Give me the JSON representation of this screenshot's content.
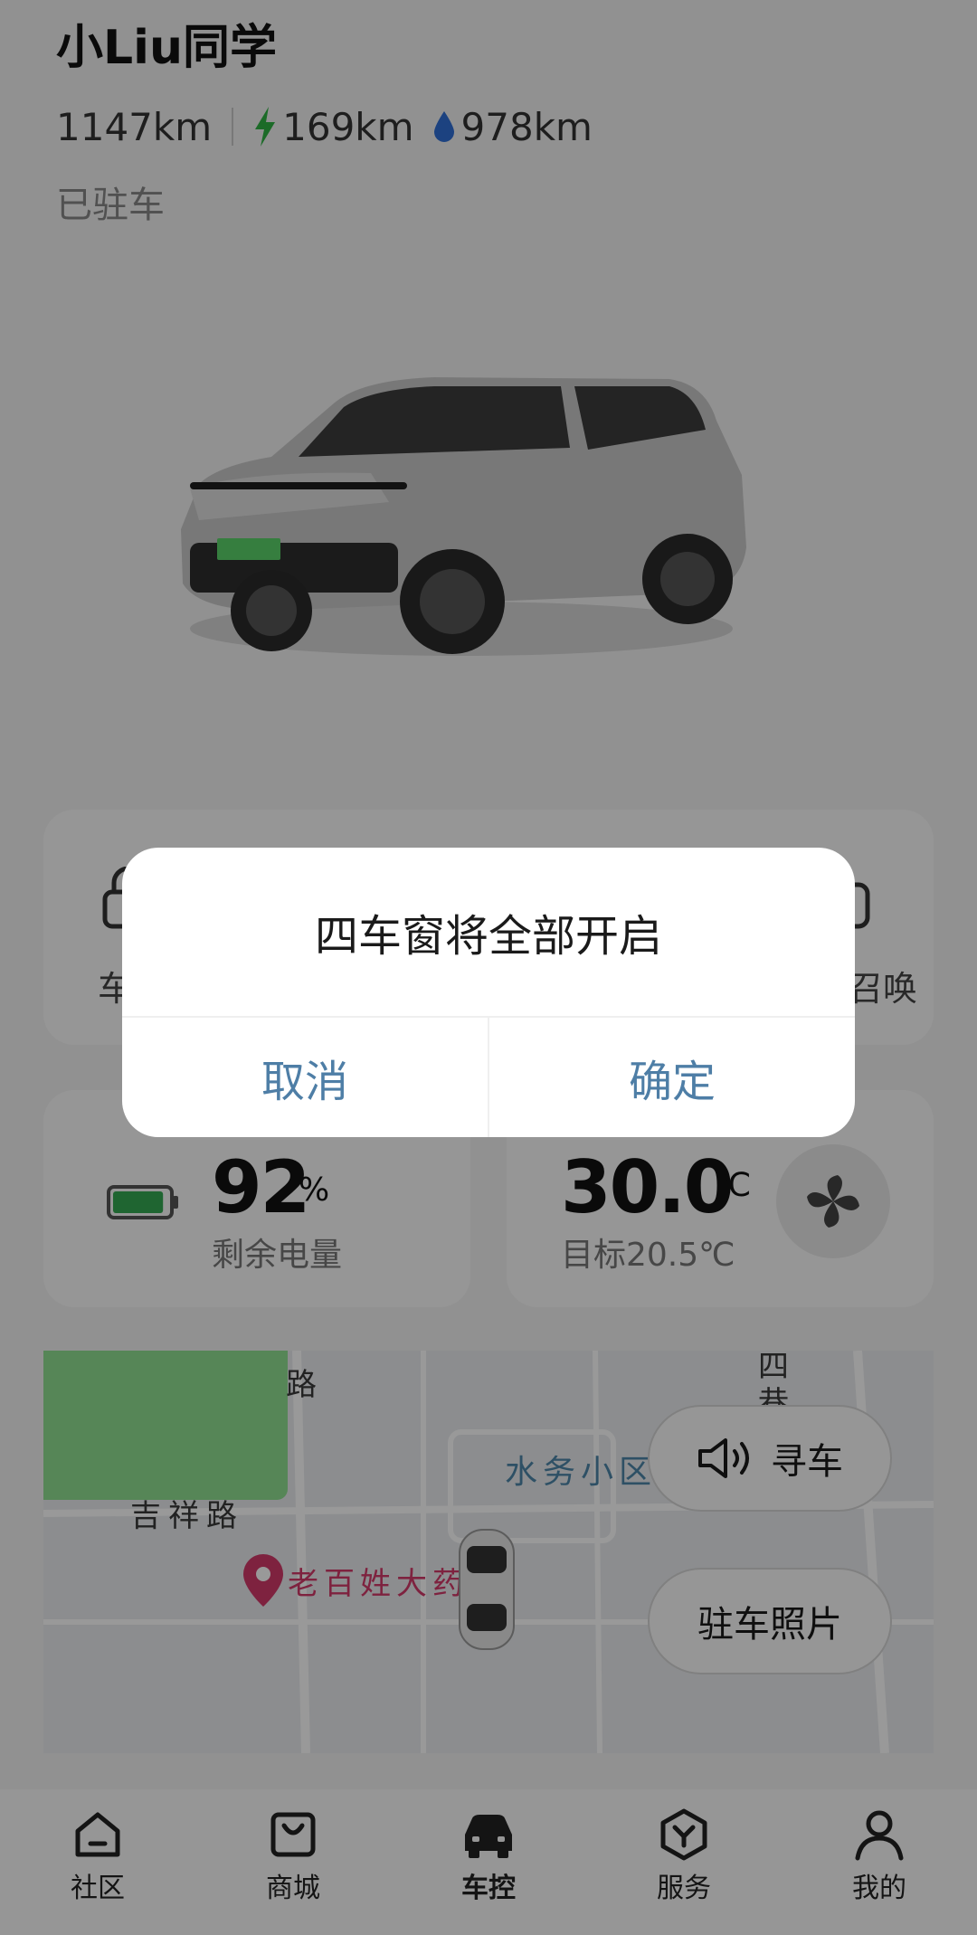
{
  "header": {
    "user_name": "小Liu同学",
    "total_range": "1147km",
    "electric_range": "169km",
    "fuel_range": "978km",
    "status": "已驻车"
  },
  "quick_controls": {
    "left_label_partial": "车",
    "right_label_partial": "召唤"
  },
  "battery": {
    "percent": "92",
    "unit": "%",
    "label": "剩余电量",
    "level": 0.92
  },
  "climate": {
    "current_temp": "30.0",
    "unit": "℃",
    "target_label": "目标20.5℃"
  },
  "map": {
    "road_label_top": "路",
    "road_label_jixiang": "吉祥路",
    "area_label": "水务小区",
    "poi_label": "老百姓大药",
    "right_top_label_1": "四",
    "right_top_label_2": "巷",
    "find_car_label": "寻车",
    "parking_photo_label": "驻车照片"
  },
  "tabs": [
    {
      "label": "社区",
      "icon": "community-icon"
    },
    {
      "label": "商城",
      "icon": "shop-bag-icon"
    },
    {
      "label": "车控",
      "icon": "car-icon",
      "active": true
    },
    {
      "label": "服务",
      "icon": "service-icon"
    },
    {
      "label": "我的",
      "icon": "profile-icon"
    }
  ],
  "dialog": {
    "message": "四车窗将全部开启",
    "cancel_label": "取消",
    "confirm_label": "确定"
  },
  "colors": {
    "accent_blue": "#4e7ea6",
    "battery_green": "#34a853",
    "bolt_green": "#2fb344",
    "drop_blue": "#2f6fd6",
    "poi_pink": "#d23a6a"
  }
}
